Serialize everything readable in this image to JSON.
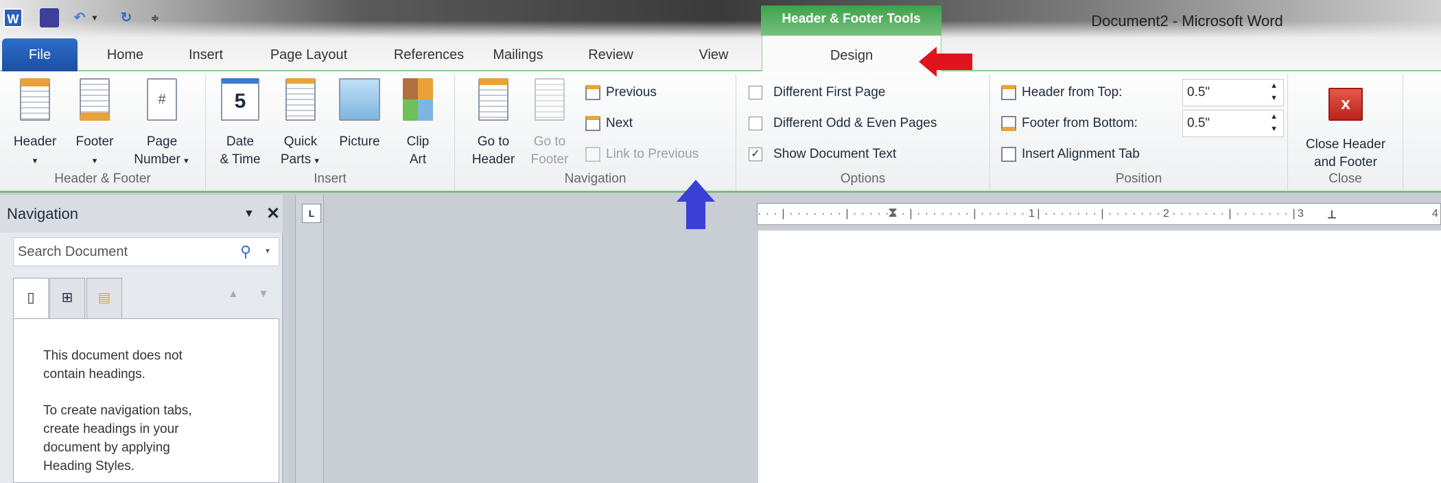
{
  "title_bar": {
    "app_title": "Document2  -  Microsoft Word",
    "contextual_tab_group": "Header & Footer Tools",
    "qat": [
      "word-icon",
      "save-icon",
      "undo-icon",
      "redo-icon",
      "customize-icon"
    ]
  },
  "tabs": [
    "File",
    "Home",
    "Insert",
    "Page Layout",
    "References",
    "Mailings",
    "Review",
    "View",
    "Design"
  ],
  "ribbon": {
    "header_footer": {
      "label": "Header & Footer",
      "header": "Header",
      "footer": "Footer",
      "page_number_1": "Page",
      "page_number_2": "Number"
    },
    "insert": {
      "label": "Insert",
      "date_1": "Date",
      "date_2": "& Time",
      "quick_1": "Quick",
      "quick_2": "Parts",
      "picture": "Picture",
      "clip_1": "Clip",
      "clip_2": "Art"
    },
    "navigation": {
      "label": "Navigation",
      "goto_header_1": "Go to",
      "goto_header_2": "Header",
      "goto_footer_1": "Go to",
      "goto_footer_2": "Footer",
      "previous": "Previous",
      "next": "Next",
      "link_previous": "Link to Previous"
    },
    "options": {
      "label": "Options",
      "different_first": "Different First Page",
      "different_odd_even": "Different Odd & Even Pages",
      "show_doc_text": "Show Document Text",
      "checked": [
        false,
        false,
        true
      ]
    },
    "position": {
      "label": "Position",
      "header_from_top": "Header from Top:",
      "header_value": "0.5\"",
      "footer_from_bottom": "Footer from Bottom:",
      "footer_value": "0.5\"",
      "insert_alignment": "Insert Alignment Tab"
    },
    "close": {
      "label": "Close",
      "close_1": "Close Header",
      "close_2": "and Footer"
    }
  },
  "navigation_pane": {
    "title": "Navigation",
    "search_placeholder": "Search Document",
    "message_1": "This document does not",
    "message_2": "contain headings.",
    "message_3": "To create navigation tabs,",
    "message_4": "create headings in your",
    "message_5": "document by applying",
    "message_6": "Heading Styles."
  },
  "ruler": {
    "labels": [
      "1",
      "2",
      "3",
      "4"
    ]
  },
  "annotations": {
    "red_arrow_color": "#e0141e",
    "blue_arrow_color": "#3a3fd6"
  }
}
